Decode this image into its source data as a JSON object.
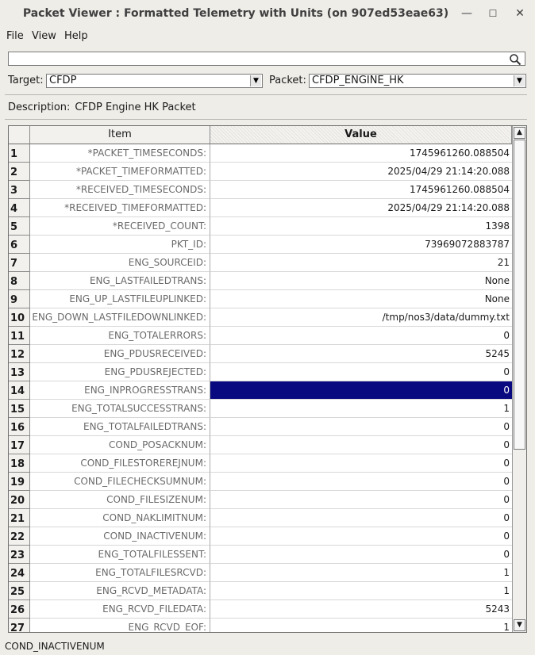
{
  "window": {
    "title": "Packet Viewer : Formatted Telemetry with Units (on 907ed53eae63)",
    "minimize": "—",
    "maximize": "☐",
    "close": "✕"
  },
  "menu": {
    "file": "File",
    "view": "View",
    "help": "Help"
  },
  "search": {
    "value": "",
    "placeholder": ""
  },
  "target": {
    "label": "Target:",
    "value": "CFDP"
  },
  "packet": {
    "label": "Packet:",
    "value": "CFDP_ENGINE_HK"
  },
  "description": {
    "label": "Description:",
    "value": "CFDP Engine HK Packet"
  },
  "table": {
    "headers": {
      "item": "Item",
      "value": "Value"
    },
    "selected_row": 14,
    "rows": [
      {
        "num": "1",
        "item": "*PACKET_TIMESECONDS:",
        "value": "1745961260.088504"
      },
      {
        "num": "2",
        "item": "*PACKET_TIMEFORMATTED:",
        "value": "2025/04/29 21:14:20.088"
      },
      {
        "num": "3",
        "item": "*RECEIVED_TIMESECONDS:",
        "value": "1745961260.088504"
      },
      {
        "num": "4",
        "item": "*RECEIVED_TIMEFORMATTED:",
        "value": "2025/04/29 21:14:20.088"
      },
      {
        "num": "5",
        "item": "*RECEIVED_COUNT:",
        "value": "1398"
      },
      {
        "num": "6",
        "item": "PKT_ID:",
        "value": "73969072883787"
      },
      {
        "num": "7",
        "item": "ENG_SOURCEID:",
        "value": "21"
      },
      {
        "num": "8",
        "item": "ENG_LASTFAILEDTRANS:",
        "value": "None"
      },
      {
        "num": "9",
        "item": "ENG_UP_LASTFILEUPLINKED:",
        "value": "None"
      },
      {
        "num": "10",
        "item": "ENG_DOWN_LASTFILEDOWNLINKED:",
        "value": "/tmp/nos3/data/dummy.txt"
      },
      {
        "num": "11",
        "item": "ENG_TOTALERRORS:",
        "value": "0"
      },
      {
        "num": "12",
        "item": "ENG_PDUSRECEIVED:",
        "value": "5245"
      },
      {
        "num": "13",
        "item": "ENG_PDUSREJECTED:",
        "value": "0"
      },
      {
        "num": "14",
        "item": "ENG_INPROGRESSTRANS:",
        "value": "0"
      },
      {
        "num": "15",
        "item": "ENG_TOTALSUCCESSTRANS:",
        "value": "1"
      },
      {
        "num": "16",
        "item": "ENG_TOTALFAILEDTRANS:",
        "value": "0"
      },
      {
        "num": "17",
        "item": "COND_POSACKNUM:",
        "value": "0"
      },
      {
        "num": "18",
        "item": "COND_FILESTOREREJNUM:",
        "value": "0"
      },
      {
        "num": "19",
        "item": "COND_FILECHECKSUMNUM:",
        "value": "0"
      },
      {
        "num": "20",
        "item": "COND_FILESIZENUM:",
        "value": "0"
      },
      {
        "num": "21",
        "item": "COND_NAKLIMITNUM:",
        "value": "0"
      },
      {
        "num": "22",
        "item": "COND_INACTIVENUM:",
        "value": "0"
      },
      {
        "num": "23",
        "item": "ENG_TOTALFILESSENT:",
        "value": "0"
      },
      {
        "num": "24",
        "item": "ENG_TOTALFILESRCVD:",
        "value": "1"
      },
      {
        "num": "25",
        "item": "ENG_RCVD_METADATA:",
        "value": "1"
      },
      {
        "num": "26",
        "item": "ENG_RCVD_FILEDATA:",
        "value": "5243"
      },
      {
        "num": "27",
        "item": "ENG_RCVD_EOF:",
        "value": "1"
      }
    ]
  },
  "scrollbar": {
    "up": "▲",
    "down": "▼"
  },
  "status": {
    "text": "COND_INACTIVENUM"
  }
}
